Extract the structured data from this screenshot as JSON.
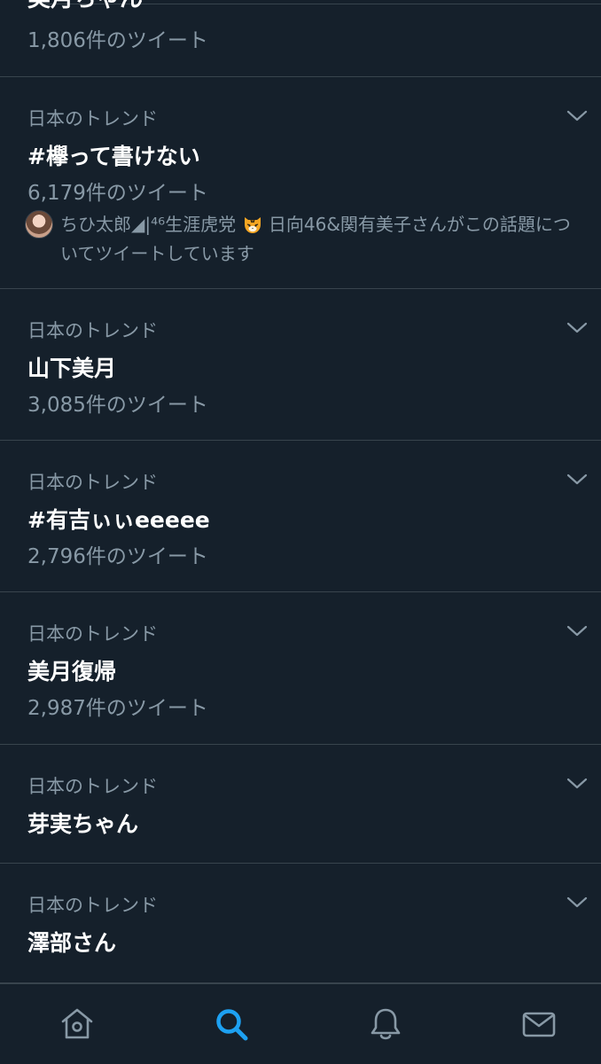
{
  "colors": {
    "background": "#15202b",
    "divider": "#38444d",
    "secondary_text": "#8899a6",
    "primary_text": "#ffffff",
    "accent": "#1da1f2"
  },
  "top_partial": {
    "title": "美月ちゃん",
    "count": "1,806件のツイート"
  },
  "trends": [
    {
      "context": "日本のトレンド",
      "name": "#欅って書けない",
      "count": "6,179件のツイート",
      "tweeted_by": {
        "prefix": "ちひ太郎◢|⁴⁶生涯虎党",
        "suffix": "日向46&関有美子さんがこの話題についてツイートしています"
      }
    },
    {
      "context": "日本のトレンド",
      "name": "山下美月",
      "count": "3,085件のツイート"
    },
    {
      "context": "日本のトレンド",
      "name": "#有吉ぃぃeeeee",
      "count": "2,796件のツイート"
    },
    {
      "context": "日本のトレンド",
      "name": "美月復帰",
      "count": "2,987件のツイート"
    },
    {
      "context": "日本のトレンド",
      "name": "芽実ちゃん"
    },
    {
      "context": "日本のトレンド",
      "name": "澤部さん"
    }
  ],
  "tabbar": {
    "items": [
      {
        "icon": "home-icon"
      },
      {
        "icon": "search-icon",
        "active": true
      },
      {
        "icon": "bell-icon"
      },
      {
        "icon": "mail-icon"
      }
    ]
  }
}
